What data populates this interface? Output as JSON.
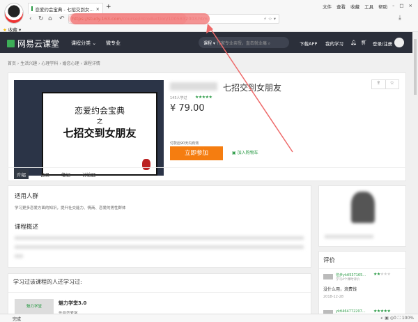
{
  "browser": {
    "tab_title": "恋爱约会宝典 - 七招交到女...",
    "new_tab": "+",
    "menu": [
      "文件",
      "查看",
      "收藏",
      "工具",
      "帮助"
    ],
    "url_host": "https://study.163.com",
    "url_path": "/course/introduction/1005832003.htm",
    "bookmarks": "收藏 ▾"
  },
  "site": {
    "logo": "网易云课堂",
    "nav": [
      "课程分类 ⌄",
      "微专业"
    ],
    "search_scope": "课程 ▾",
    "search_placeholder": "行家专业亲授，直击就业痛",
    "links": [
      "下载APP",
      "我的学习"
    ],
    "login": "登录/注册"
  },
  "breadcrumb": "首页 › 生活兴趣 › 心理学科 › 婚恋心理 › 课程详情",
  "course": {
    "cover_line1": "恋爱约会宝典",
    "cover_line2": "之",
    "cover_line3": "七招交到女朋友",
    "title": "七招交到女朋友",
    "learners": "145人学过",
    "rating_stars": 5,
    "price": "¥ 79.00",
    "validity": "付款后90天内有效",
    "buy": "立即参加",
    "cart": "加入购物车"
  },
  "tabs": [
    "介绍",
    "目录",
    "笔记",
    "讨论区"
  ],
  "intro": {
    "audience_h": "适用人群",
    "audience": "学习更多恋爱方面的知识，提升社交能力、情商、恋爱的男性群体",
    "overview_h": "课程概述"
  },
  "also": {
    "heading": "学习过该课程的人还学习过:",
    "course_thumb": "魅力学堂",
    "course_title": "魅力学堂3.0",
    "course_sub": "乐音恋爱学"
  },
  "reviews": {
    "heading": "评价",
    "items": [
      {
        "user": "信步yktl537165...",
        "stars": 2,
        "meta": "学习4个课时评价",
        "text": "没什么用，浪费钱",
        "date": "2018-12-28"
      },
      {
        "user": "yktl464772207...",
        "stars": 5
      }
    ]
  },
  "status": {
    "left": "完成",
    "zoom": "100%",
    "count": "0"
  }
}
